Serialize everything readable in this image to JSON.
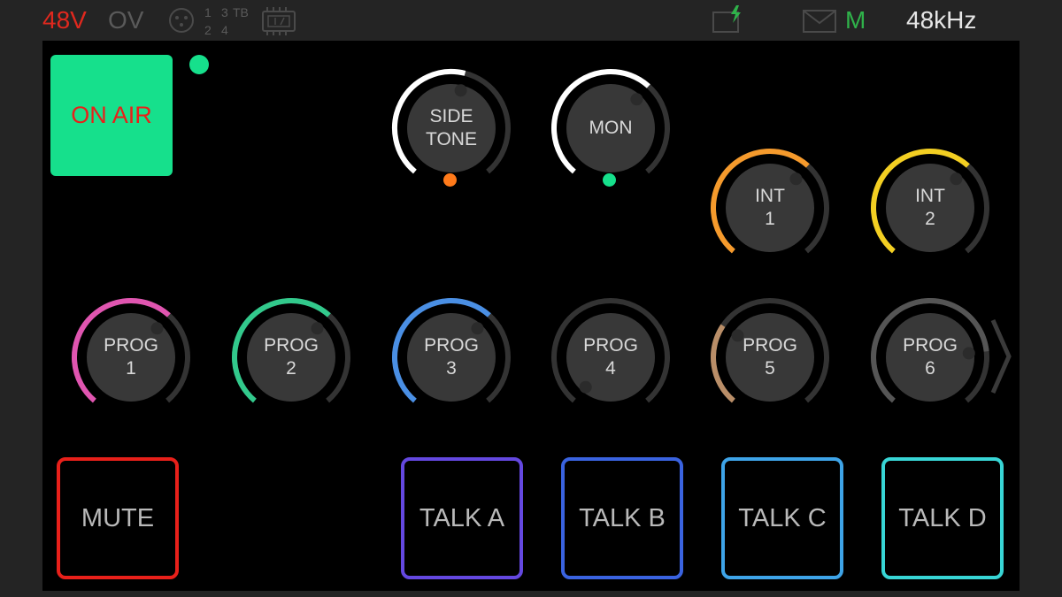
{
  "status_bar": {
    "phantom_power": {
      "label": "48V",
      "color": "#e0281e"
    },
    "overvoltage": {
      "label": "OV",
      "color": "#5a5a5a"
    },
    "ports": {
      "digits": [
        "1",
        "3",
        "2",
        "4"
      ],
      "tb_label": "TB"
    },
    "meter_color": "#e0281e",
    "message": {
      "label": "M",
      "color": "#2fb24a"
    },
    "sample_rate": {
      "label": "48kHz",
      "color": "#e6e6e6"
    },
    "icons": [
      "xlr-connector-icon",
      "io-chip-icon",
      "battery-charging-icon",
      "mail-icon"
    ]
  },
  "on_air": {
    "label": "ON AIR",
    "bg_color": "#16e08c",
    "text_color": "#e8201a",
    "led_color": "#16e08c"
  },
  "knobs": [
    {
      "id": "sidetone",
      "line1": "SIDE",
      "line2": "TONE",
      "color": "#ffffff",
      "level": 0.55,
      "led_color": "#ff7a1a"
    },
    {
      "id": "mon",
      "line1": "MON",
      "line2": "",
      "color": "#ffffff",
      "level": 0.65,
      "led_color": "#16e08c"
    },
    {
      "id": "int-1",
      "line1": "INT",
      "line2": "1",
      "color": "#f59a2c",
      "level": 0.65
    },
    {
      "id": "int-2",
      "line1": "INT",
      "line2": "2",
      "color": "#f3cf22",
      "level": 0.65
    },
    {
      "id": "prog-1",
      "line1": "PROG",
      "line2": "1",
      "color": "#e055b0",
      "level": 0.65
    },
    {
      "id": "prog-2",
      "line1": "PROG",
      "line2": "2",
      "color": "#32c98c",
      "level": 0.65
    },
    {
      "id": "prog-3",
      "line1": "PROG",
      "line2": "3",
      "color": "#4a8fe4",
      "level": 0.65
    },
    {
      "id": "prog-4",
      "line1": "PROG",
      "line2": "4",
      "color": "#555555",
      "level": 0.0
    },
    {
      "id": "prog-5",
      "line1": "PROG",
      "line2": "5",
      "color": "#b98e68",
      "level": 0.3
    },
    {
      "id": "prog-6",
      "line1": "PROG",
      "line2": "6",
      "color": "#555555",
      "level": 0.8
    }
  ],
  "pads": [
    {
      "id": "mute",
      "label": "MUTE",
      "color": "#e8201a"
    },
    {
      "id": "talk-a",
      "label": "TALK A",
      "color": "#6448e0"
    },
    {
      "id": "talk-b",
      "label": "TALK B",
      "color": "#3a63e0"
    },
    {
      "id": "talk-c",
      "label": "TALK C",
      "color": "#3ea4e8"
    },
    {
      "id": "talk-d",
      "label": "TALK D",
      "color": "#38d6d6"
    }
  ],
  "theme": {
    "track_color": "#333333",
    "knob_body_color": "#383838",
    "indicator_color": "#2b2b2b",
    "chevron_color": "#3a3a3a"
  }
}
